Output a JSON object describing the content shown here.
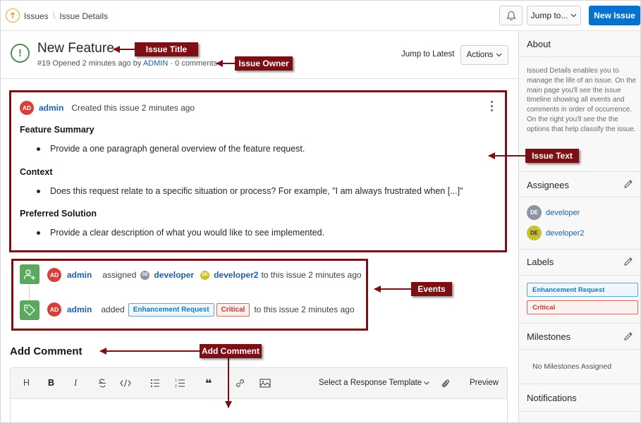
{
  "topbar": {
    "crumb_root": "Issues",
    "crumb_current": "Issue Details",
    "jump_label": "Jump to...",
    "new_issue_label": "New Issue"
  },
  "header": {
    "title": "New Feature",
    "sub_prefix": "#19 Opened 2 minutes ago by",
    "owner": "ADMIN",
    "sub_suffix": "· 0 comments",
    "jump_latest": "Jump to Latest",
    "actions_label": "Actions"
  },
  "issue": {
    "avatar": "AD",
    "user": "admin",
    "meta": "Created this issue 2 minutes ago",
    "sections": [
      {
        "heading": "Feature Summary",
        "bullet": "Provide a one paragraph general overview of the feature request."
      },
      {
        "heading": "Context",
        "bullet": "Does this request relate to a specific situation or process? For example, \"I am always frustrated when [...]\""
      },
      {
        "heading": "Preferred Solution",
        "bullet": "Provide a clear description of what you would like to see implemented."
      }
    ]
  },
  "events": [
    {
      "avatar": "AD",
      "user": "admin",
      "verb": "assigned",
      "a1_initials": "DE",
      "a1": "developer",
      "a2_initials": "DE",
      "a2": "developer2",
      "tail": "to this issue 2 minutes ago"
    },
    {
      "avatar": "AD",
      "user": "admin",
      "verb": "added",
      "label1": "Enhancement Request",
      "label2": "Critical",
      "tail": "to this issue 2 minutes ago"
    }
  ],
  "comment": {
    "heading": "Add Comment",
    "toolbar": {
      "h": "H",
      "bold": "B",
      "italic": "I",
      "quote": "❝",
      "template": "Select a Response Template",
      "preview": "Preview"
    }
  },
  "sidebar": {
    "about_heading": "About",
    "about_text": "Issued Details enables you to manage the life of an issue. On the main page you'll see the issue timeline showing all events and comments in order of occurrence. On the right you'll see the the options that help classify the issue.",
    "assignees_heading": "Assignees",
    "assignees": [
      {
        "initials": "DE",
        "name": "developer"
      },
      {
        "initials": "DE",
        "name": "developer2"
      }
    ],
    "labels_heading": "Labels",
    "labels": [
      "Enhancement Request",
      "Critical"
    ],
    "milestones_heading": "Milestones",
    "milestones_empty": "No Milestones Assigned",
    "notifications_heading": "Notifications"
  },
  "annotations": {
    "issue_title": "Issue Title",
    "issue_owner": "Issue Owner",
    "issue_text": "Issue Text",
    "events": "Events",
    "add_comment": "Add Comment"
  },
  "colors": {
    "primary": "#0572ce",
    "annotation": "#7d0f14",
    "event_icon": "#5ca85f",
    "avatar_admin": "#d6403b",
    "avatar_developer": "#8b95a3",
    "avatar_developer2": "#c9c12a",
    "status_open": "#4e8a58"
  }
}
